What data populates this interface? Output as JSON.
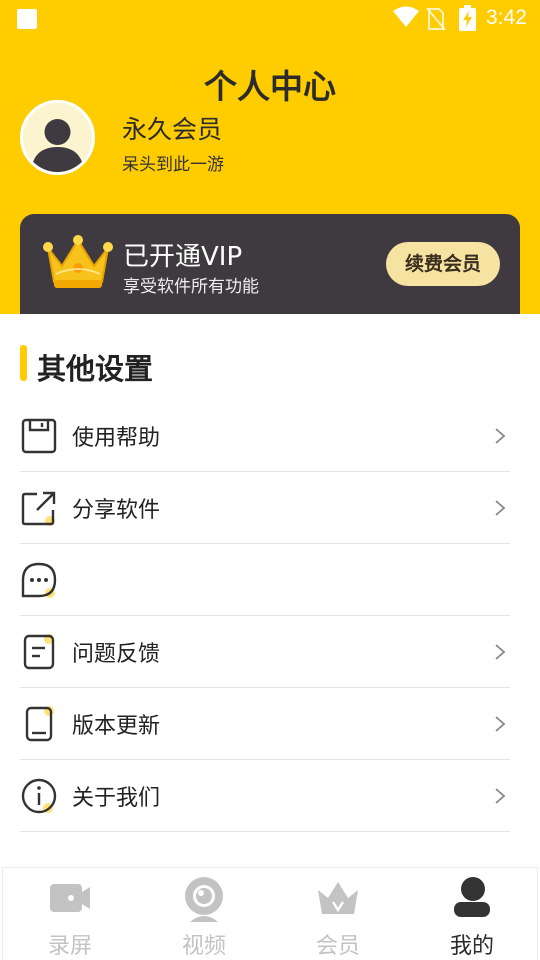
{
  "status_bar": {
    "time": "3:42"
  },
  "header": {
    "title": "个人中心",
    "user_name": "永久会员",
    "user_subtitle": "呆头到此一游",
    "background_color": "#FFCC00"
  },
  "vip_card": {
    "title": "已开通VIP",
    "subtitle": "享受软件所有功能",
    "renew_label": "续费会员",
    "background_color": "#3F3A3F"
  },
  "section": {
    "title": "其他设置"
  },
  "menu": {
    "items": [
      {
        "icon": "floppy-icon",
        "label": "使用帮助",
        "has_chevron": true
      },
      {
        "icon": "share-icon",
        "label": "分享软件",
        "has_chevron": true
      },
      {
        "icon": "chat-icon",
        "label": "",
        "has_chevron": false
      },
      {
        "icon": "document-icon",
        "label": "问题反馈",
        "has_chevron": true
      },
      {
        "icon": "phone-icon",
        "label": "版本更新",
        "has_chevron": true
      },
      {
        "icon": "info-icon",
        "label": "关于我们",
        "has_chevron": true
      }
    ]
  },
  "tabbar": {
    "tabs": [
      {
        "icon": "video-camera-icon",
        "label": "录屏",
        "active": false
      },
      {
        "icon": "webcam-icon",
        "label": "视频",
        "active": false
      },
      {
        "icon": "crown-icon",
        "label": "会员",
        "active": false
      },
      {
        "icon": "user-icon",
        "label": "我的",
        "active": true
      }
    ]
  }
}
